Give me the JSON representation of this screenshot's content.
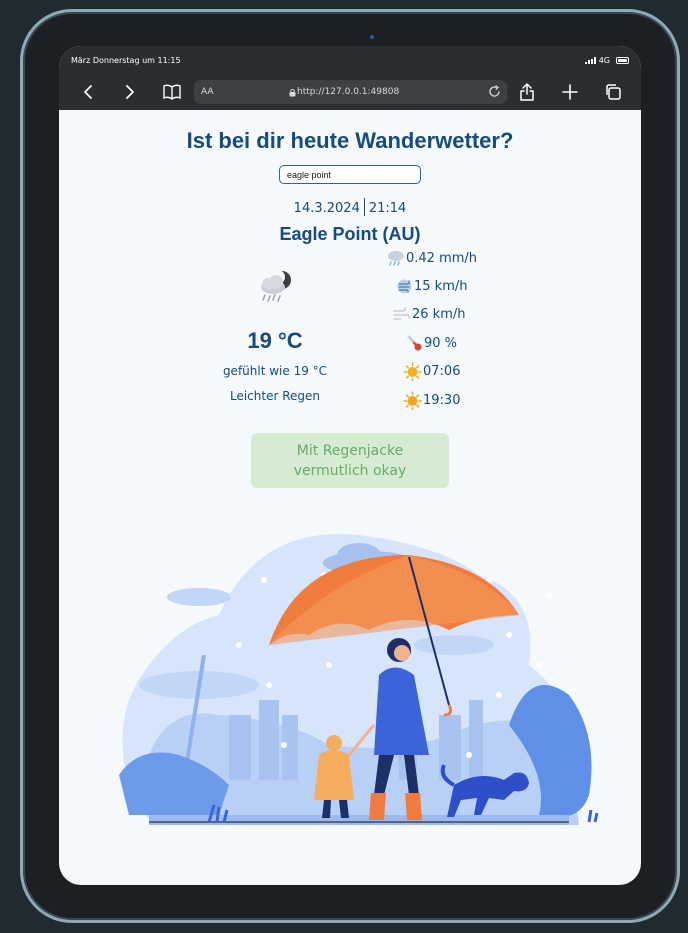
{
  "status_bar": {
    "time": "März Donnerstag um 11:15",
    "network": "4G"
  },
  "browser": {
    "text_size_label": "AA",
    "url": "http://127.0.0.1:49808"
  },
  "page": {
    "title": "Ist bei dir heute Wanderwetter?",
    "search_value": "eagle point",
    "date": "14.3.2024",
    "time": "21:14",
    "location": "Eagle Point (AU)",
    "condition_icon": "cloud-rain-moon-icon",
    "temperature": "19 °C",
    "feels_like": "gefühlt wie 19 °C",
    "description": "Leichter Regen",
    "metrics": {
      "precipitation": "0.42 mm/h",
      "wind": "15 km/h",
      "gusts": "26 km/h",
      "humidity": "90 %",
      "sunrise": "07:06",
      "sunset": "19:30"
    },
    "advice_line1": "Mit Regenjacke",
    "advice_line2": "vermutlich okay"
  },
  "colors": {
    "heading": "#154b7d",
    "advice_bg": "#d5ecd2",
    "advice_text": "#6aa96a",
    "page_bg": "#f5f9fc",
    "browser_chrome": "#2b2e31"
  }
}
